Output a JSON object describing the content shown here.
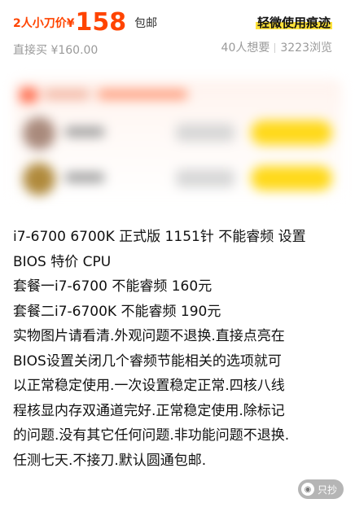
{
  "price": {
    "prefix": "2人小刀价¥",
    "value": "158",
    "shipping": "包邮",
    "direct_buy": "直接买 ¥160.00",
    "condition_tag": "轻微使用痕迹"
  },
  "stats": {
    "wants": "40人想要",
    "views": "3223浏览"
  },
  "bargain_card": {
    "blurred": true,
    "accent_color": "#ff6a4a",
    "button_color": "#ffd91a",
    "rows": [
      {
        "avatar_color": "#a98a7c"
      },
      {
        "avatar_color": "#b08a3c"
      }
    ]
  },
  "description": {
    "lines": [
      "i7-6700 6700K 正式版 1151针 不能睿频 设置",
      "BIOS 特价 CPU",
      "套餐一i7-6700 不能睿频 160元",
      "套餐二i7-6700K 不能睿频 190元",
      "实物图片请看清.外观问题不退换.直接点亮在",
      "BIOS设置关闭几个睿频节能相关的选项就可",
      "以正常稳定使用.一次设置稳定正常.四核八线",
      "程核显内存双通道完好.正常稳定使用.除标记",
      "的问题.没有其它任何问题.非功能问题不退换.",
      "任测七天.不接刀.默认圆通包邮."
    ]
  },
  "watermark": {
    "icon": "camera-icon",
    "label": "只抄"
  },
  "colors": {
    "price": "#ff4400",
    "muted": "#9a9a9a",
    "highlight": "#ffe23a"
  }
}
